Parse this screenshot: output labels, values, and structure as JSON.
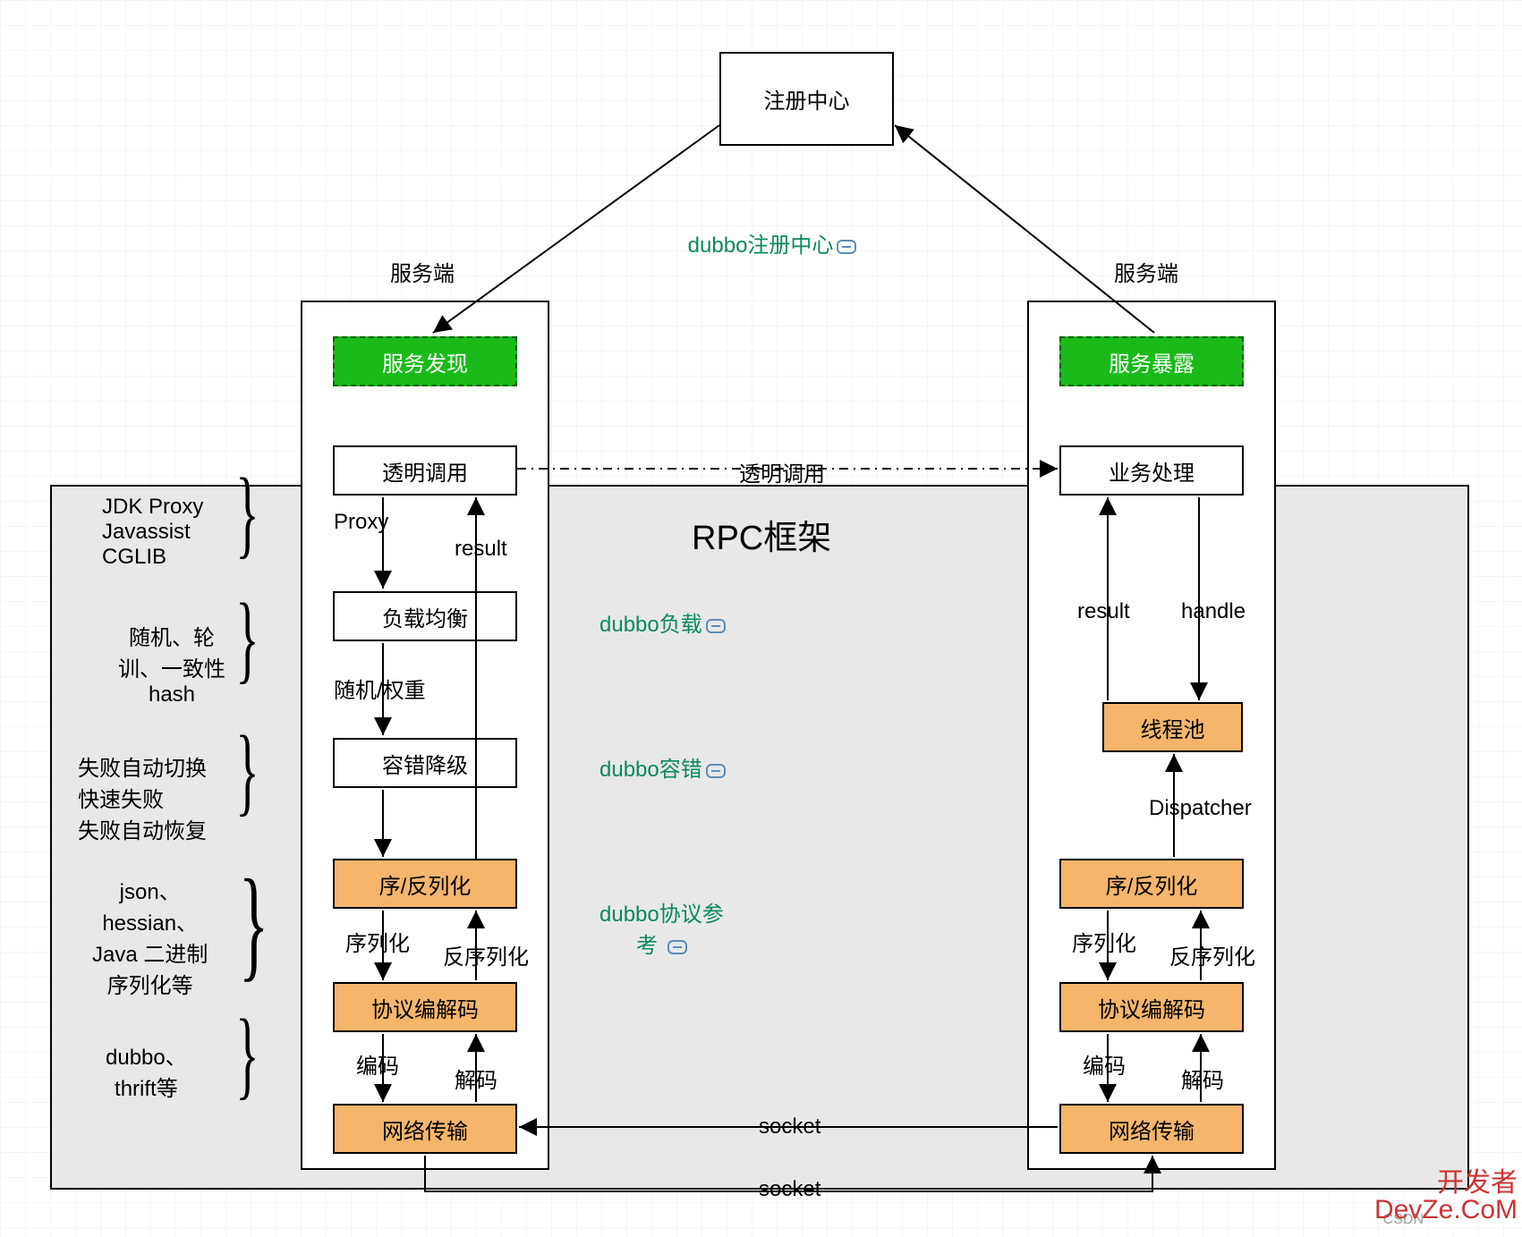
{
  "registry": {
    "label": "注册中心"
  },
  "annotations": {
    "registry_link": "dubbo注册中心",
    "load_link": "dubbo负载",
    "fault_link": "dubbo容错",
    "protocol_link": "dubbo协议参\n考"
  },
  "client": {
    "title": "服务端",
    "discovery": "服务发现",
    "invoke": "透明调用",
    "loadbalance": "负载均衡",
    "fault": "容错降级",
    "serialize": "序/反列化",
    "codec": "协议编解码",
    "transport": "网络传输",
    "arrows": {
      "proxy": "Proxy",
      "result": "result",
      "random": "随机/权重",
      "ser": "序列化",
      "deser": "反序列化",
      "encode": "编码",
      "decode": "解码"
    }
  },
  "server": {
    "title": "服务端",
    "expose": "服务暴露",
    "biz": "业务处理",
    "threadpool": "线程池",
    "serialize": "序/反列化",
    "codec": "协议编解码",
    "transport": "网络传输",
    "arrows": {
      "result": "result",
      "handle": "handle",
      "dispatcher": "Dispatcher",
      "ser": "序列化",
      "deser": "反序列化",
      "encode": "编码",
      "decode": "解码"
    }
  },
  "rpc": {
    "title": "RPC框架"
  },
  "middle": {
    "transparent": "透明调用",
    "socket1": "socket",
    "socket2": "socket"
  },
  "sidenotes": {
    "proxy": "JDK Proxy\nJavassist\nCGLIB",
    "lb": "随机、轮\n训、一致性\nhash",
    "fault": "失败自动切换\n快速失败\n失败自动恢复",
    "ser": "json、\nhessian、\nJava 二进制\n序列化等",
    "codec": "dubbo、\nthrift等"
  },
  "watermark": {
    "csdn": "CSDN",
    "devze": "开发者\nDevZe.CoM"
  }
}
